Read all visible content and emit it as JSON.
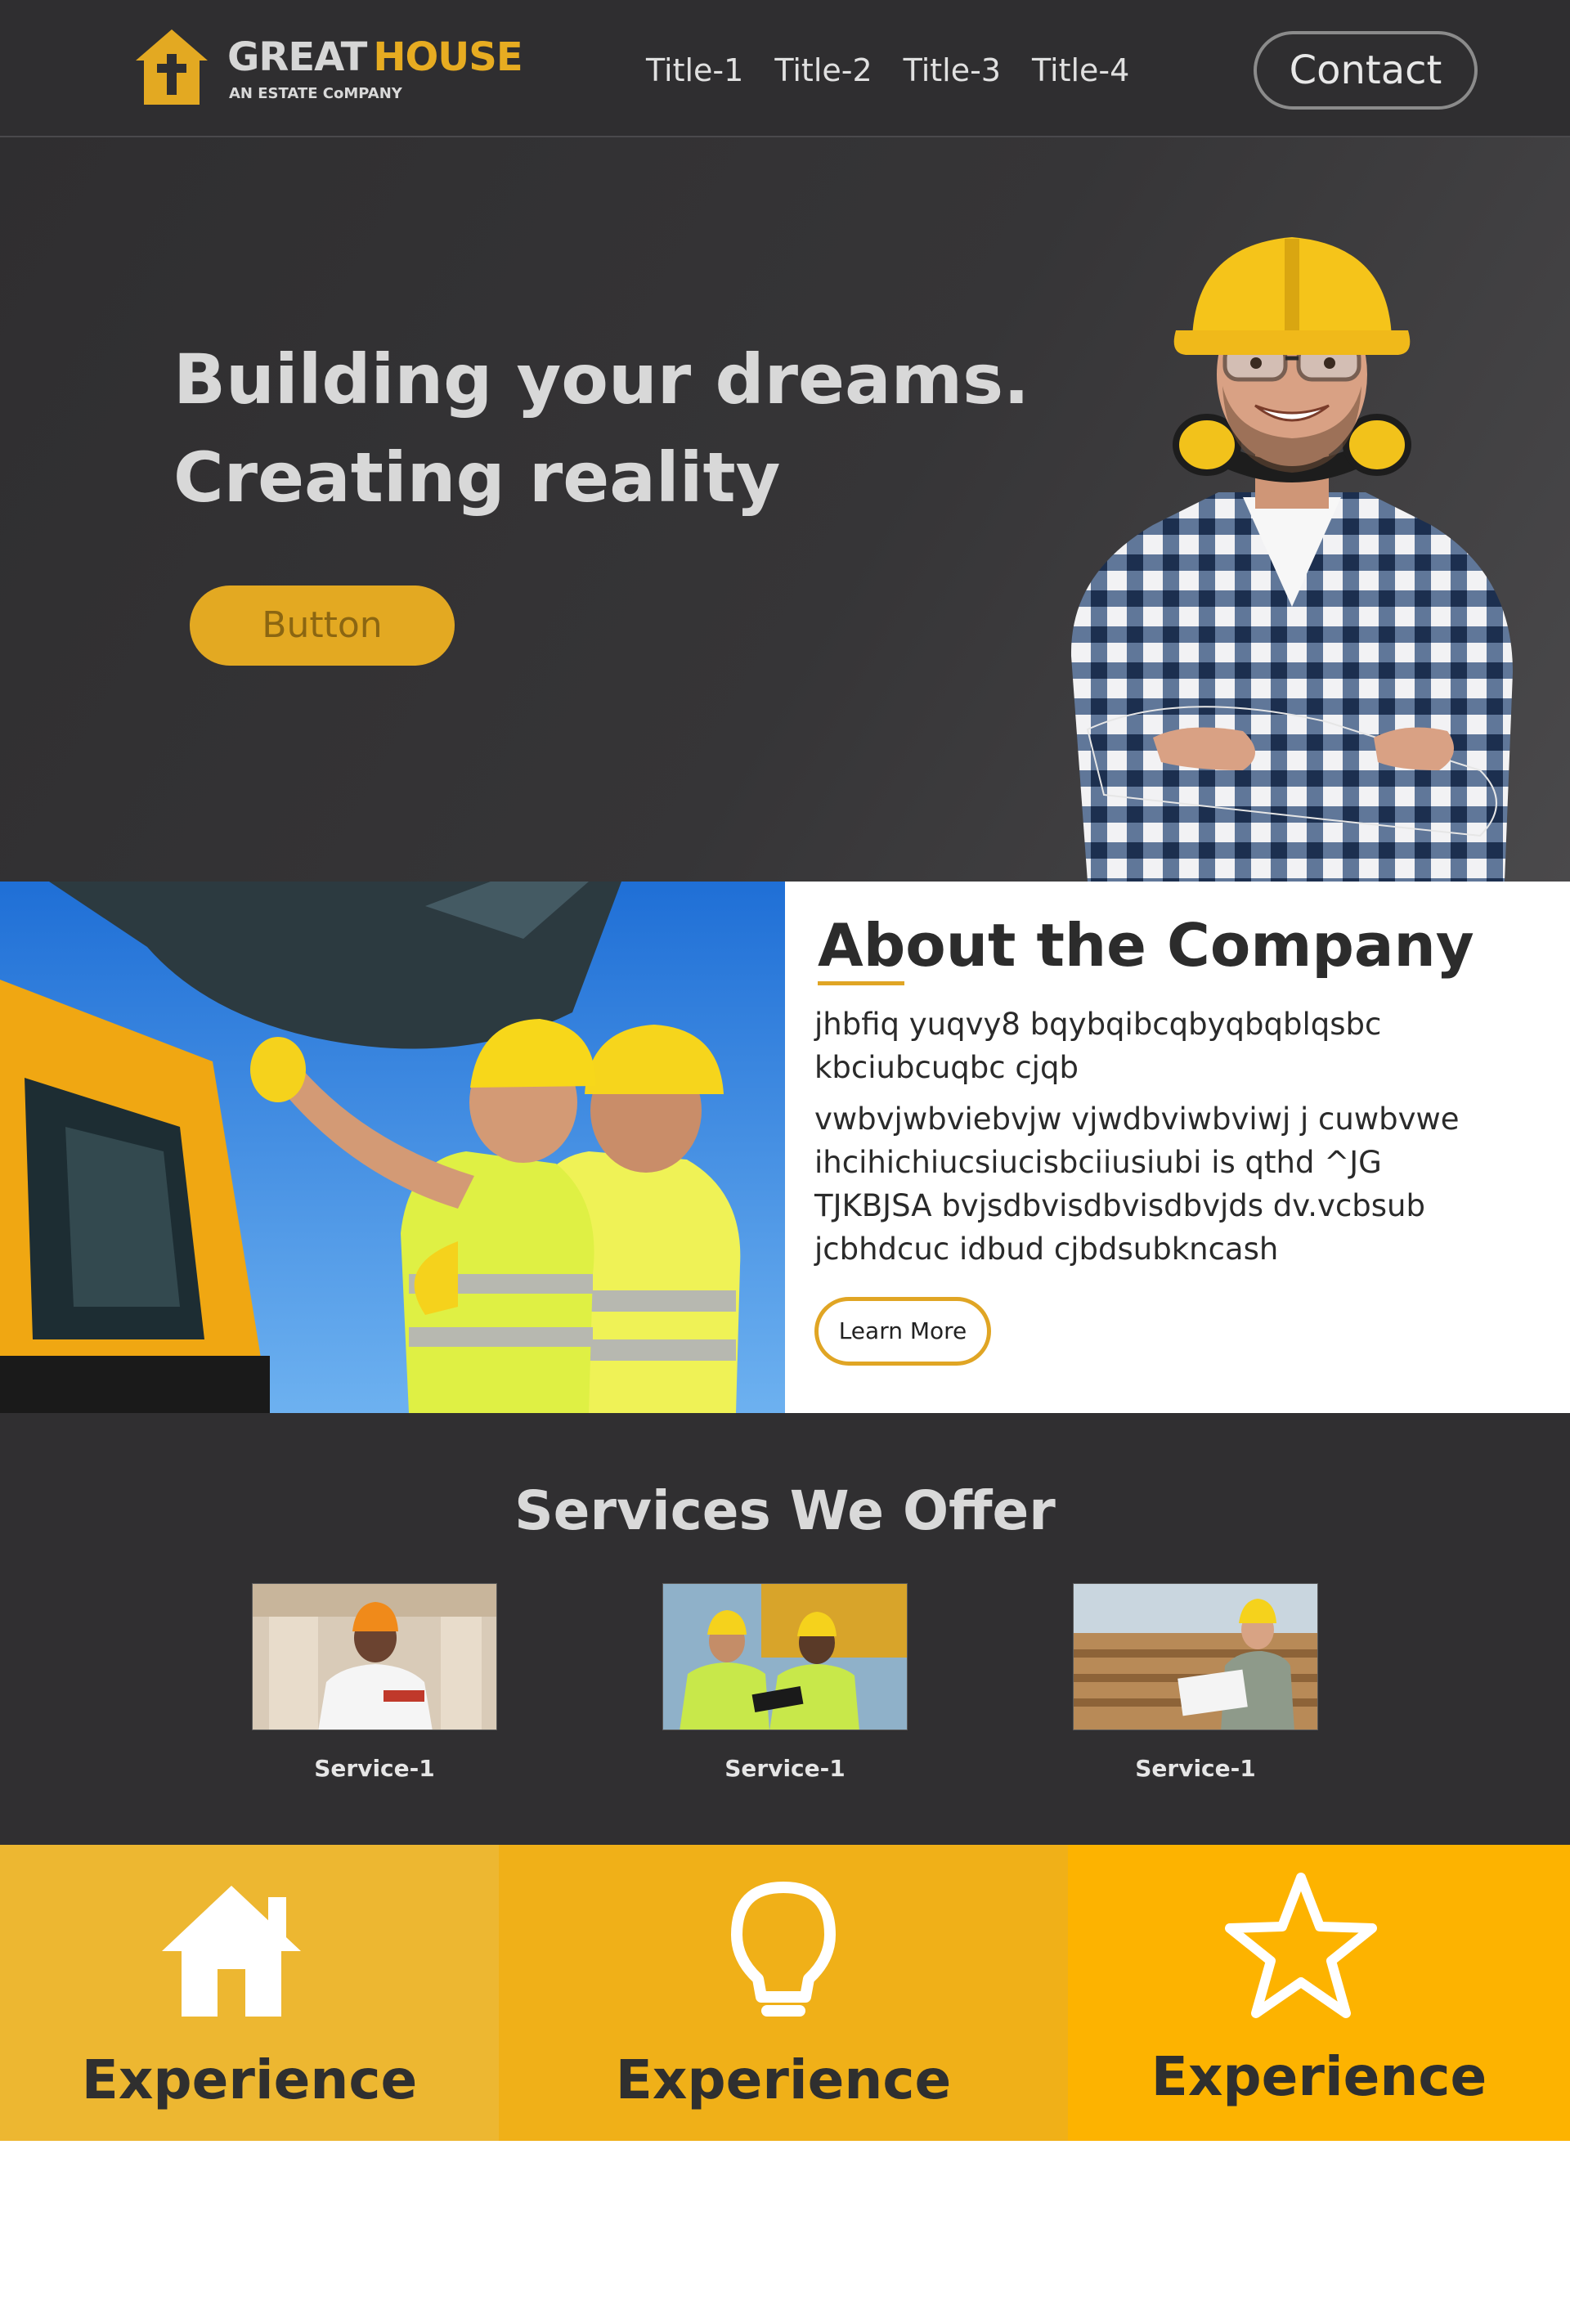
{
  "header": {
    "logo_word_1": "GREAT",
    "logo_word_2": "HOUSE",
    "logo_tagline": "AN ESTATE CoMPANY",
    "nav": [
      "Title-1",
      "Title-2",
      "Title-3",
      "Title-4"
    ],
    "contact_label": "Contact"
  },
  "hero": {
    "title_line_1": "Building your dreams.",
    "title_line_2": "Creating reality",
    "button_label": "Button"
  },
  "about": {
    "title": "About the Company",
    "paragraph_1": [
      "jhbfiq yuqvy8 bqybqibcqbyqbqblqsbc",
      "kbciubcuqbc cjqb"
    ],
    "paragraph_2": [
      "vwbvjwbviebvjw vjwdbviwbviwj j cuwbvwe",
      "ihcihichiucsiucisbciiusiubi  is qthd ^JG",
      "TJKBJSA bvjsdbvisdbvisdbvjds dv.vcbsub",
      "jcbhdcuc idbud   cjbdsubkncash"
    ],
    "learn_more_label": "Learn More"
  },
  "services": {
    "title": "Services We Offer",
    "items": [
      {
        "label": "Service-1"
      },
      {
        "label": "Service-1"
      },
      {
        "label": "Service-1"
      }
    ]
  },
  "experience": {
    "items": [
      {
        "icon": "house-icon",
        "label": "Experience"
      },
      {
        "icon": "lightbulb-icon",
        "label": "Experience"
      },
      {
        "icon": "star-icon",
        "label": "Experience"
      }
    ]
  },
  "colors": {
    "header_bg": "#2f2e30",
    "accent": "#e3a922",
    "services_bg": "#302f31",
    "exp_1": "#edb731",
    "exp_2": "#f0b018",
    "exp_3": "#fdb300"
  }
}
